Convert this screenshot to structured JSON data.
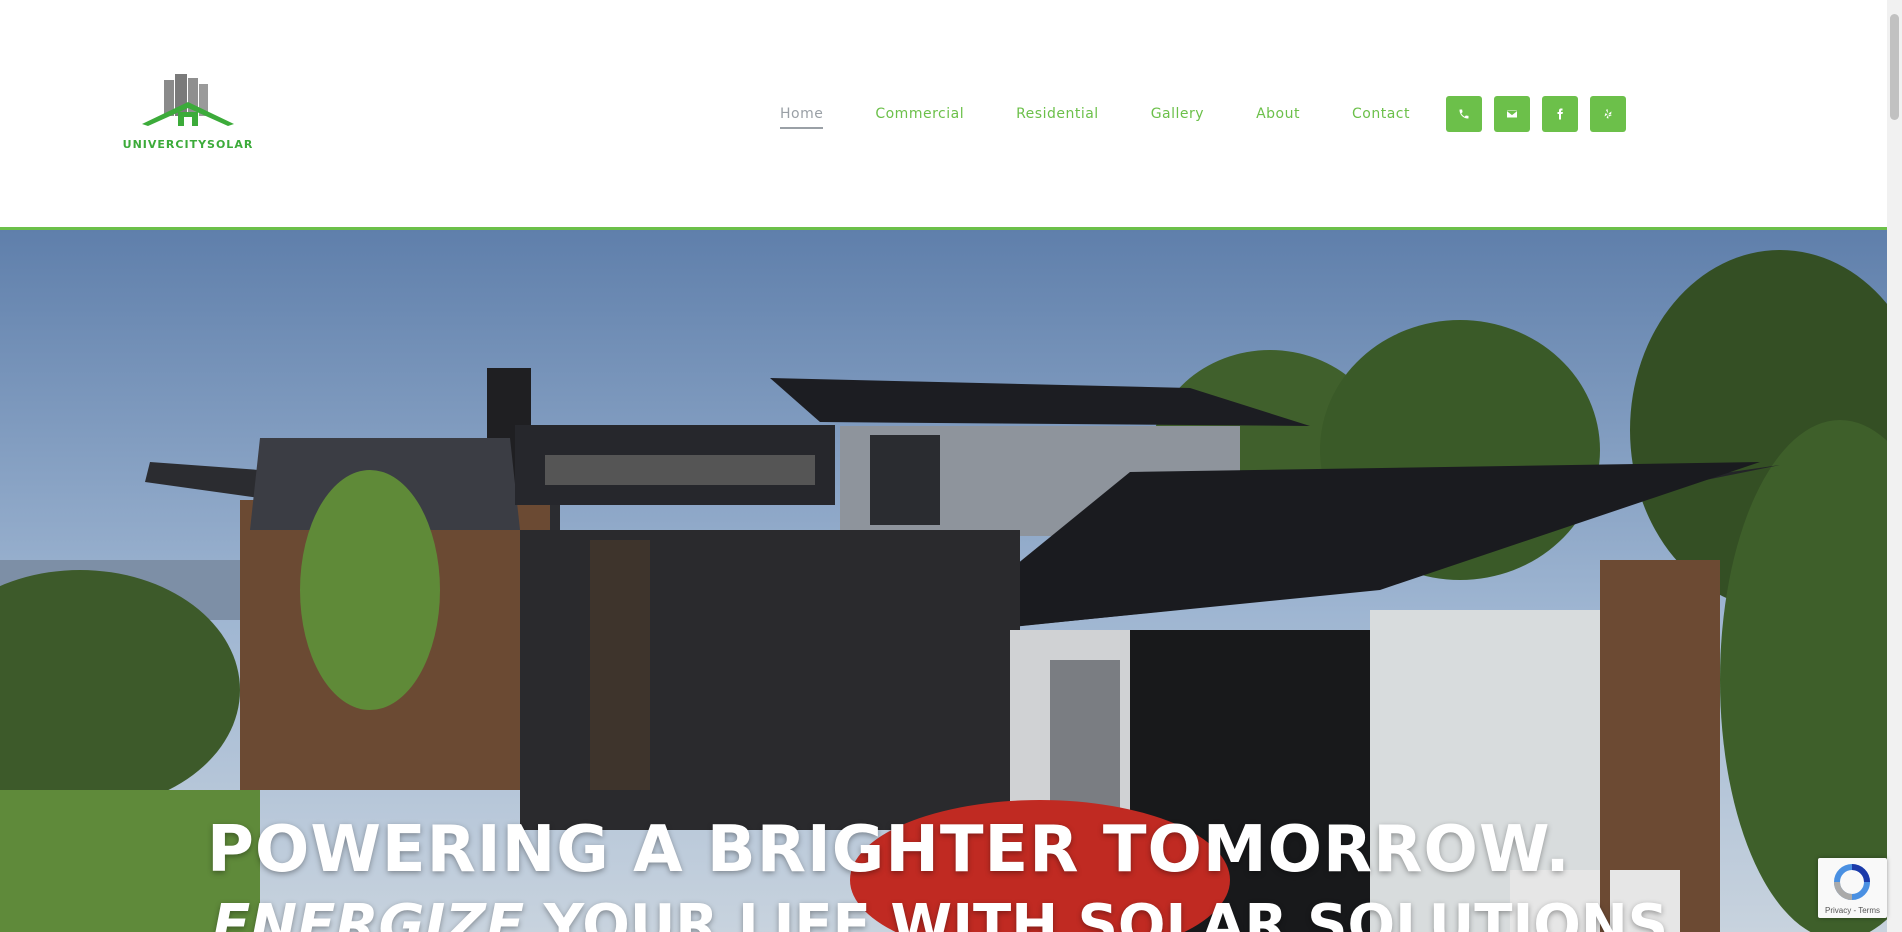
{
  "brand": {
    "name": "UNIVERCITYSOLAR",
    "colors": {
      "accent": "#6cc04a",
      "active_nav": "#9aa0a6"
    }
  },
  "nav": {
    "items": [
      {
        "label": "Home",
        "active": true
      },
      {
        "label": "Commercial"
      },
      {
        "label": "Residential"
      },
      {
        "label": "Gallery"
      },
      {
        "label": "About"
      },
      {
        "label": "Contact"
      }
    ],
    "social": [
      "phone-icon",
      "email-icon",
      "facebook-icon",
      "yelp-icon"
    ]
  },
  "hero": {
    "headline": "POWERING A BRIGHTER TOMORROW.",
    "sub_italic": "ENERGIZE",
    "sub_rest": " YOUR LIFE WITH SOLAR SOLUTIONS"
  },
  "recaptcha": {
    "links": "Privacy - Terms"
  }
}
